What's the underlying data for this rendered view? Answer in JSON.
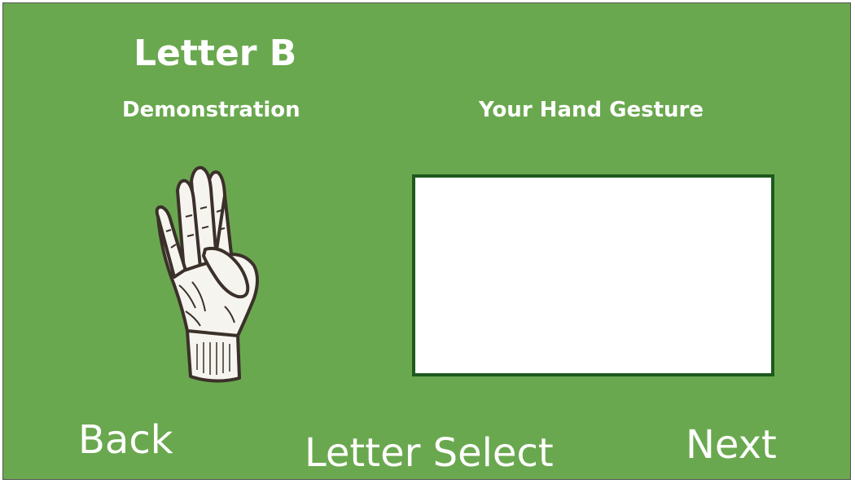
{
  "header": {
    "title": "Letter B",
    "demo_label": "Demonstration",
    "gesture_label": "Your Hand Gesture"
  },
  "demo": {
    "icon": "hand-sign-b-icon"
  },
  "nav": {
    "back_label": "Back",
    "select_label": "Letter Select",
    "next_label": "Next"
  },
  "colors": {
    "background": "#6aa84f",
    "gesture_border": "#1e5a1e",
    "text": "#ffffff"
  }
}
